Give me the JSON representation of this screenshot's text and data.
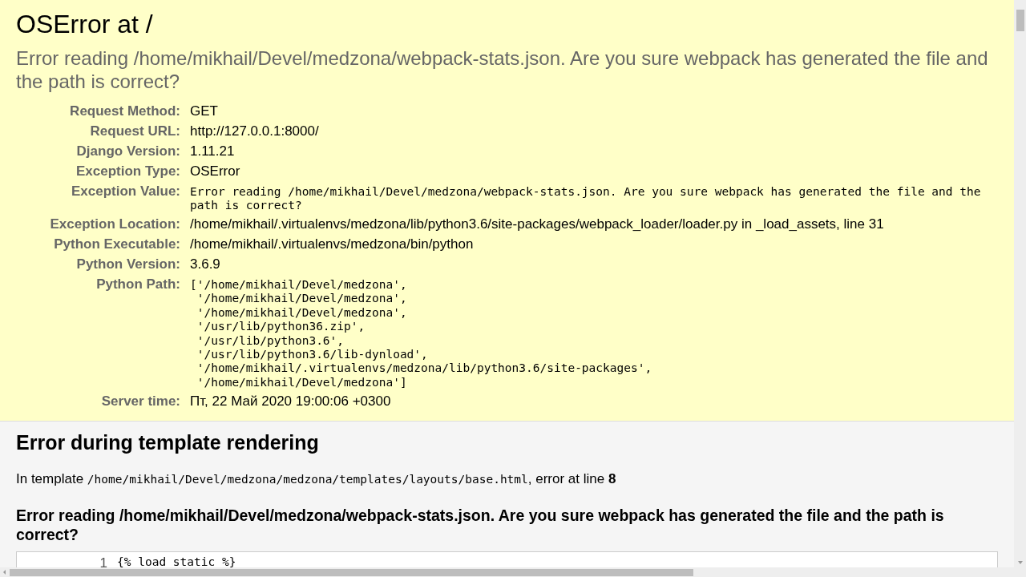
{
  "summary": {
    "title": "OSError at /",
    "subtitle": "Error reading /home/mikhail/Devel/medzona/webpack-stats.json. Are you sure webpack has generated the file and the path is correct?",
    "meta": [
      {
        "label": "Request Method:",
        "kind": "text",
        "value": "GET"
      },
      {
        "label": "Request URL:",
        "kind": "text",
        "value": "http://127.0.0.1:8000/"
      },
      {
        "label": "Django Version:",
        "kind": "text",
        "value": "1.11.21"
      },
      {
        "label": "Exception Type:",
        "kind": "text",
        "value": "OSError"
      },
      {
        "label": "Exception Value:",
        "kind": "mono",
        "value": "Error reading /home/mikhail/Devel/medzona/webpack-stats.json. Are you sure webpack has generated the file and the path is correct?"
      },
      {
        "label": "Exception Location:",
        "kind": "text",
        "value": "/home/mikhail/.virtualenvs/medzona/lib/python3.6/site-packages/webpack_loader/loader.py in _load_assets, line 31"
      },
      {
        "label": "Python Executable:",
        "kind": "text",
        "value": "/home/mikhail/.virtualenvs/medzona/bin/python"
      },
      {
        "label": "Python Version:",
        "kind": "text",
        "value": "3.6.9"
      },
      {
        "label": "Python Path:",
        "kind": "list",
        "values": [
          "['/home/mikhail/Devel/medzona',",
          " '/home/mikhail/Devel/medzona',",
          " '/home/mikhail/Devel/medzona',",
          " '/usr/lib/python36.zip',",
          " '/usr/lib/python3.6',",
          " '/usr/lib/python3.6/lib-dynload',",
          " '/home/mikhail/.virtualenvs/medzona/lib/python3.6/site-packages',",
          " '/home/mikhail/Devel/medzona']"
        ]
      },
      {
        "label": "Server time:",
        "kind": "text",
        "value": "Пт, 22 Май 2020 19:00:06 +0300"
      }
    ]
  },
  "template": {
    "heading": "Error during template rendering",
    "prefix": "In template ",
    "path": "/home/mikhail/Devel/medzona/medzona/templates/layouts/base.html",
    "middle": ", error at line ",
    "line": "8",
    "message": "Error reading /home/mikhail/Devel/medzona/webpack-stats.json. Are you sure webpack has generated the file and the path is correct?",
    "source": [
      {
        "number": "1",
        "code": "{% load static %}"
      }
    ]
  }
}
